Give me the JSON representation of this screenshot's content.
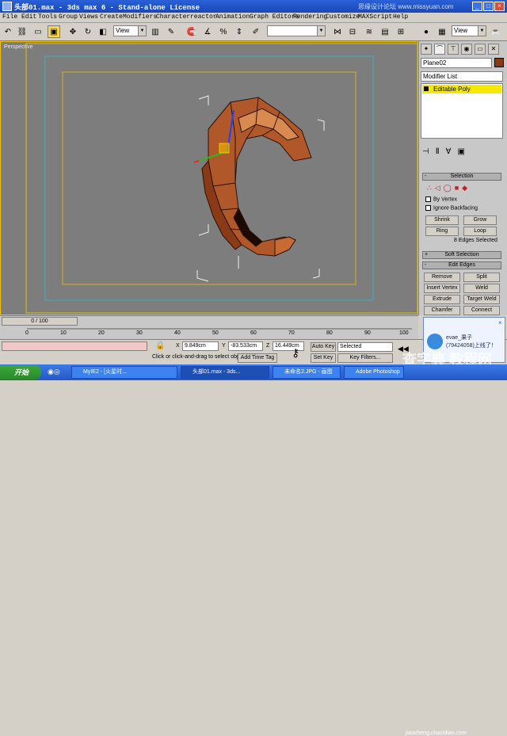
{
  "window": {
    "title": "头部01.max - 3ds max 6 - Stand-alone License",
    "watermark": "思缘设计论坛 www.missyuan.com",
    "controls": [
      "_",
      "□",
      "×"
    ]
  },
  "menu": [
    "File",
    "Edit",
    "Tools",
    "Group",
    "Views",
    "Create",
    "Modifiers",
    "Character",
    "reactor",
    "Animation",
    "Graph Editors",
    "Rendering",
    "Customize",
    "MAXScript",
    "Help"
  ],
  "toolbar": {
    "ref_coord": "View",
    "named_sel": "",
    "view2": "View"
  },
  "viewport": {
    "label": "Perspective",
    "bg_color": "#7d7d7d",
    "active_border": "#f0c000"
  },
  "command_panel": {
    "object_name": "Plane02",
    "object_color": "#8b3a0f",
    "modifier_list": "Modifier List",
    "stack_item": "Editable Poly",
    "selection_rollout": "Selection",
    "by_vertex": "By Vertex",
    "ignore_backfacing": "Ignore Backfacing",
    "shrink": "Shrink",
    "grow": "Grow",
    "ring": "Ring",
    "loop": "Loop",
    "selected_info": "8 Edges Selected",
    "soft_selection": "Soft Selection",
    "edit_edges": "Edit Edges",
    "remove": "Remove",
    "split": "Split",
    "insert_vertex": "Insert Vertex",
    "weld": "Weld",
    "extrude": "Extrude",
    "target_weld": "Target Weld",
    "chamfer": "Chamfer",
    "connect": "Connect"
  },
  "timeline": {
    "slider": "0 / 100",
    "ticks": [
      "0",
      "10",
      "20",
      "30",
      "40",
      "50",
      "60",
      "70",
      "80",
      "90",
      "100"
    ]
  },
  "status": {
    "prompt": "Click or click-and-drag to select obj",
    "x": "9.849cm",
    "y": "-83.533cm",
    "z": "16.449cm",
    "x_label": "X",
    "y_label": "Y",
    "z_label": "Z",
    "add_time_tag": "Add Time Tag",
    "auto_key": "Auto Key",
    "selected": "Selected",
    "set_key": "Set Key",
    "key_filters": "Key Filters..."
  },
  "taskbar": {
    "start": "开始",
    "tasks": [
      "MyIE2 - [火星时...",
      "头部01.max - 3ds...",
      "未命名2.JPG - 画图",
      "Adobe Photoshop"
    ]
  },
  "popup": {
    "name": "evae_果子",
    "text": "(79424058)上线了！"
  },
  "watermark_bottom": "查字典 教程网",
  "watermark_url": "jiaocheng.chazidian.com"
}
